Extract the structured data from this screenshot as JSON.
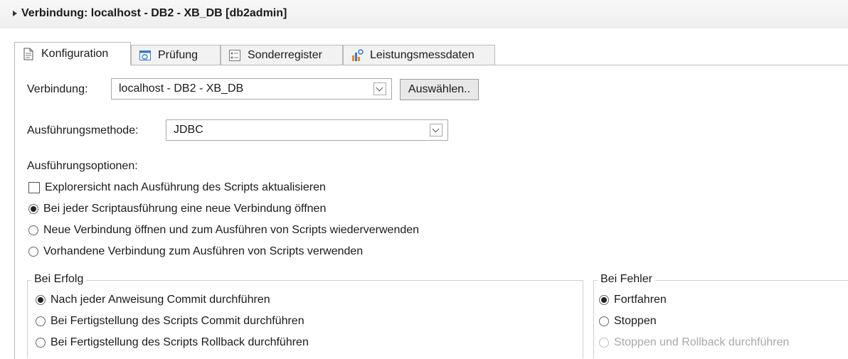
{
  "header": {
    "title": "Verbindung: localhost - DB2 - XB_DB [db2admin]"
  },
  "tabs": [
    {
      "label": "Konfiguration",
      "icon": "document-icon",
      "active": true
    },
    {
      "label": "Prüfung",
      "icon": "validation-icon",
      "active": false
    },
    {
      "label": "Sonderregister",
      "icon": "register-list-icon",
      "active": false
    },
    {
      "label": "Leistungsmessdaten",
      "icon": "performance-chart-icon",
      "active": false
    }
  ],
  "config": {
    "connection_label": "Verbindung:",
    "connection_value": "localhost - DB2 - XB_DB",
    "select_button": "Auswählen..",
    "method_label": "Ausführungsmethode:",
    "method_value": "JDBC",
    "options_label": "Ausführungsoptionen:",
    "refresh_explorer": {
      "label": "Explorersicht nach Ausführung des Scripts aktualisieren",
      "checked": false
    },
    "connection_modes": [
      {
        "label": "Bei jeder Scriptausführung eine neue Verbindung öffnen",
        "selected": true
      },
      {
        "label": "Neue Verbindung öffnen und zum Ausführen von Scripts wiederverwenden",
        "selected": false
      },
      {
        "label": "Vorhandene Verbindung zum Ausführen von Scripts verwenden",
        "selected": false
      }
    ]
  },
  "on_success": {
    "title": "Bei Erfolg",
    "options": [
      {
        "label": "Nach jeder Anweisung Commit durchführen",
        "selected": true
      },
      {
        "label": "Bei Fertigstellung des Scripts Commit durchführen",
        "selected": false
      },
      {
        "label": "Bei Fertigstellung des Scripts Rollback durchführen",
        "selected": false
      }
    ]
  },
  "on_error": {
    "title": "Bei Fehler",
    "options": [
      {
        "label": "Fortfahren",
        "selected": true
      },
      {
        "label": "Stoppen",
        "selected": false
      },
      {
        "label": "Stoppen und Rollback durchführen",
        "selected": false,
        "disabled": true
      }
    ]
  }
}
